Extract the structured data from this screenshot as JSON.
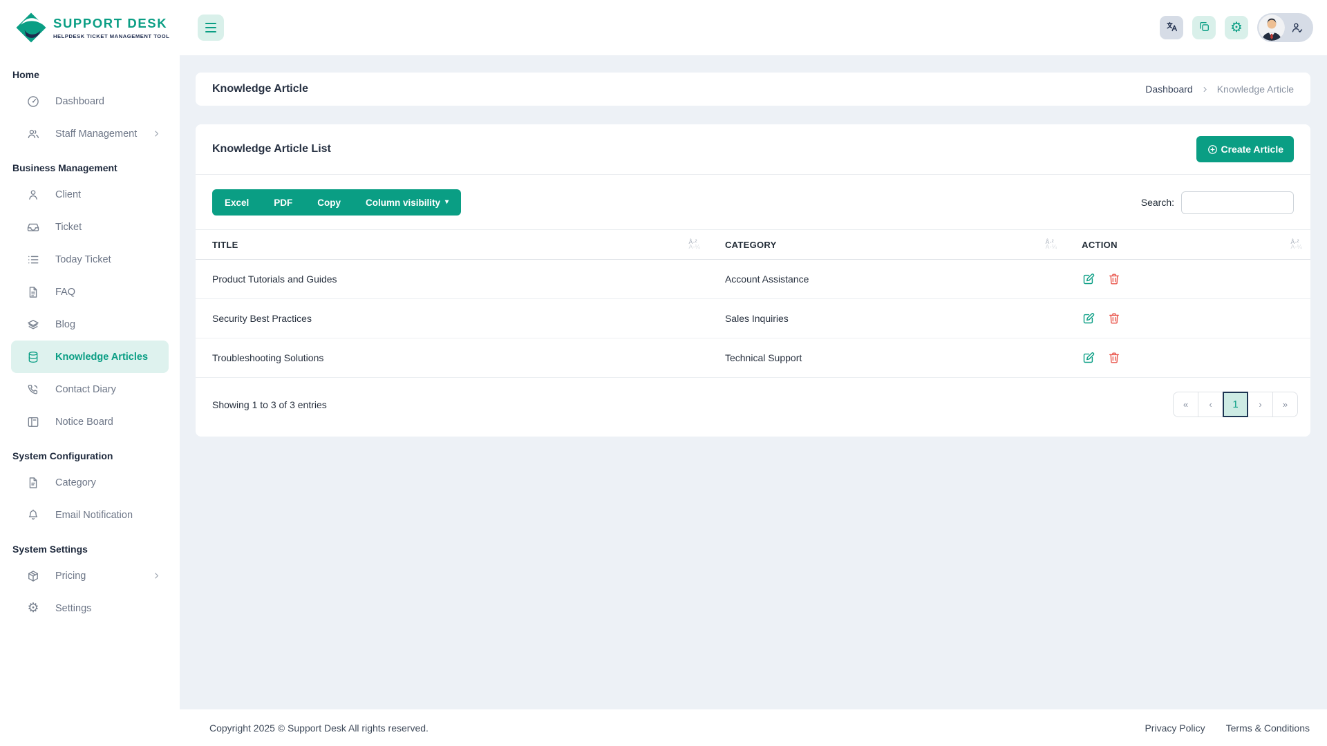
{
  "brand": {
    "name": "SUPPORT DESK",
    "tagline": "HELPDESK TICKET MANAGEMENT TOOL"
  },
  "topbar": {
    "icons": [
      "translate-icon",
      "copy-icon",
      "gear-icon",
      "profile-avatar",
      "person-check-icon"
    ]
  },
  "sidebar": {
    "sections": [
      {
        "label": "Home",
        "items": [
          {
            "label": "Dashboard",
            "icon": "dashboard-icon"
          },
          {
            "label": "Staff Management",
            "icon": "users-icon",
            "chevron": true
          }
        ]
      },
      {
        "label": "Business Management",
        "items": [
          {
            "label": "Client",
            "icon": "person-icon"
          },
          {
            "label": "Ticket",
            "icon": "inbox-icon"
          },
          {
            "label": "Today Ticket",
            "icon": "list-icon"
          },
          {
            "label": "FAQ",
            "icon": "file-text-icon"
          },
          {
            "label": "Blog",
            "icon": "layers-icon"
          },
          {
            "label": "Knowledge Articles",
            "icon": "database-icon",
            "active": true
          },
          {
            "label": "Contact Diary",
            "icon": "phone-icon"
          },
          {
            "label": "Notice Board",
            "icon": "board-icon"
          }
        ]
      },
      {
        "label": "System Configuration",
        "items": [
          {
            "label": "Category",
            "icon": "file-icon"
          },
          {
            "label": "Email Notification",
            "icon": "bell-icon"
          }
        ]
      },
      {
        "label": "System Settings",
        "items": [
          {
            "label": "Pricing",
            "icon": "package-icon",
            "chevron": true
          },
          {
            "label": "Settings",
            "icon": "gear-icon"
          }
        ]
      }
    ]
  },
  "page": {
    "title": "Knowledge Article",
    "breadcrumb": {
      "parent": "Dashboard",
      "current": "Knowledge Article"
    }
  },
  "list_card": {
    "title": "Knowledge Article List",
    "create_button_label": "Create Article",
    "export_buttons": [
      "Excel",
      "PDF",
      "Copy"
    ],
    "column_visibility_label": "Column visibility",
    "search_label": "Search:",
    "search_value": ""
  },
  "table": {
    "columns": [
      "TITLE",
      "CATEGORY",
      "ACTION"
    ],
    "rows": [
      {
        "title": "Product Tutorials and Guides",
        "category": "Account Assistance"
      },
      {
        "title": "Security Best Practices",
        "category": "Sales Inquiries"
      },
      {
        "title": "Troubleshooting Solutions",
        "category": "Technical Support"
      }
    ],
    "info": "Showing 1 to 3 of 3 entries"
  },
  "pagination": {
    "first_label": "«",
    "prev_label": "‹",
    "pages": [
      "1"
    ],
    "active_page": "1",
    "next_label": "›",
    "last_label": "»"
  },
  "footer": {
    "copyright": "Copyright 2025 © Support Desk All rights reserved.",
    "links": [
      "Privacy Policy",
      "Terms & Conditions"
    ]
  },
  "colors": {
    "primary": "#0a9e84",
    "primary_light": "#d9f0ea",
    "danger": "#e9564c",
    "navy": "#22314f",
    "main_bg": "#edf1f6"
  }
}
